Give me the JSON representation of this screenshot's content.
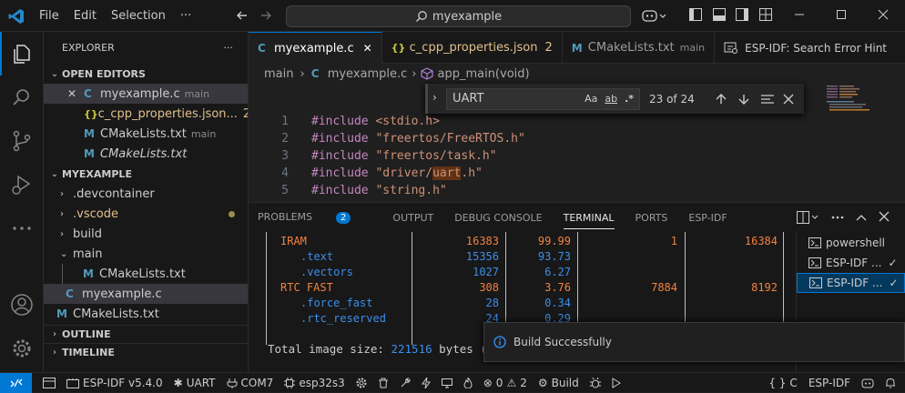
{
  "menu": {
    "file": "File",
    "edit": "Edit",
    "selection": "Selection",
    "more": "···"
  },
  "command_center": {
    "text": "myexample"
  },
  "sidebar": {
    "title": "EXPLORER",
    "more": "···",
    "open_editors": {
      "label": "OPEN EDITORS",
      "items": [
        {
          "icon": "C",
          "name": "myexample.c",
          "suffix": "main",
          "close": "✕"
        },
        {
          "icon": "{}",
          "name": "c_cpp_properties.json...",
          "badge": "2"
        },
        {
          "icon": "M",
          "name": "CMakeLists.txt",
          "suffix": "main"
        },
        {
          "icon": "M",
          "name": "CMakeLists.txt"
        }
      ]
    },
    "project": {
      "label": "MYEXAMPLE",
      "items": [
        {
          "name": ".devcontainer"
        },
        {
          "name": ".vscode"
        },
        {
          "name": "build"
        },
        {
          "name": "main"
        },
        {
          "icon": "M",
          "name": "CMakeLists.txt"
        },
        {
          "icon": "C",
          "name": "myexample.c"
        },
        {
          "icon": "M",
          "name": "CMakeLists.txt"
        }
      ]
    },
    "outline": "OUTLINE",
    "timeline": "TIMELINE"
  },
  "tabs": [
    {
      "icon": "C",
      "name": "myexample.c",
      "close": "✕"
    },
    {
      "icon": "{}",
      "name": "c_cpp_properties.json",
      "badge": "2"
    },
    {
      "icon": "M",
      "name": "CMakeLists.txt",
      "suffix": "main"
    },
    {
      "name": "ESP-IDF: Search Error Hint"
    }
  ],
  "breadcrumb": {
    "folder": "main",
    "file": "myexample.c",
    "symbol": "app_main(void)"
  },
  "find": {
    "query": "UART",
    "match_case": "Aa",
    "whole_word": "ab",
    "regex": ".*",
    "count": "23 of 24"
  },
  "editor": {
    "lines": [
      {
        "n": "1",
        "kw": "#include",
        "arg": " <stdio.h>"
      },
      {
        "n": "2",
        "kw": "#include",
        "arg": " \"freertos/FreeRTOS.h\""
      },
      {
        "n": "3",
        "kw": "#include",
        "arg": " \"freertos/task.h\""
      },
      {
        "n": "4",
        "kw": "#include",
        "pre": " \"driver/",
        "hl": "uart",
        "post": ".h\""
      },
      {
        "n": "5",
        "kw": "#include",
        "arg": " \"string.h\""
      }
    ]
  },
  "panel": {
    "tabs": {
      "problems": "PROBLEMS",
      "problems_badge": "2",
      "output": "OUTPUT",
      "debug": "DEBUG CONSOLE",
      "terminal": "TERMINAL",
      "ports": "PORTS",
      "espidf": "ESP-IDF"
    },
    "terminal_rows": [
      {
        "name": "IRAM",
        "c1": "16383",
        "c2": "99.99",
        "c3": "1",
        "c4": "16384"
      },
      {
        "name": ".text",
        "c1": "15356",
        "c2": "93.73",
        "c3": "",
        "c4": ""
      },
      {
        "name": ".vectors",
        "c1": "1027",
        "c2": "6.27",
        "c3": "",
        "c4": ""
      },
      {
        "name": "RTC FAST",
        "c1": "308",
        "c2": "3.76",
        "c3": "7884",
        "c4": "8192"
      },
      {
        "name": ".force_fast",
        "c1": "28",
        "c2": "0.34",
        "c3": "",
        "c4": ""
      },
      {
        "name": ".rtc_reserved",
        "c1": "24",
        "c2": "0.29",
        "c3": "",
        "c4": ""
      }
    ],
    "total": {
      "prefix": "Total image size: ",
      "value": "221516",
      "suffix": " bytes (.b"
    },
    "terminals": [
      {
        "name": "powershell"
      },
      {
        "name": "ESP-IDF ...",
        "check": "✓"
      },
      {
        "name": "ESP-IDF ...",
        "check": "✓"
      }
    ]
  },
  "toast": {
    "text": "Build Successfully"
  },
  "status": {
    "idf": "ESP-IDF v5.4.0",
    "uart": "UART",
    "port": "COM7",
    "target": "esp32s3",
    "errors": "0",
    "warnings": "2",
    "build": "Build",
    "lang": "C",
    "idf2": "ESP-IDF"
  },
  "colors": {
    "accent": "#0078d4",
    "terminal_orange": "#f1813f",
    "terminal_blue": "#3b8eea"
  }
}
